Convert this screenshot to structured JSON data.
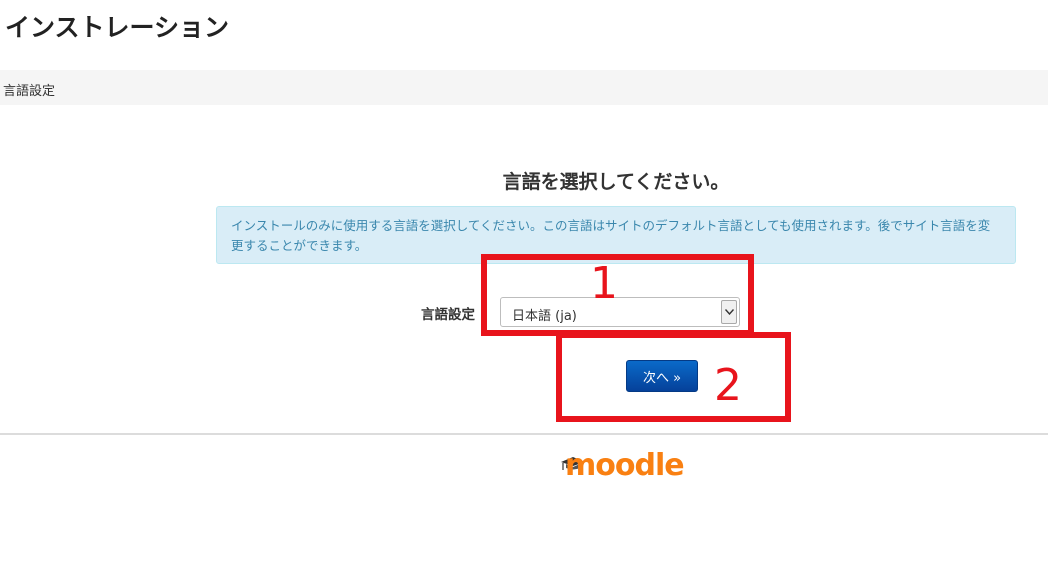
{
  "header": {
    "title": "インストレーション"
  },
  "breadcrumb": {
    "label": "言語設定"
  },
  "main": {
    "heading": "言語を選択してください。",
    "notice": "インストールのみに使用する言語を選択してください。この言語はサイトのデフォルト言語としても使用されます。後でサイト言語を変更することができます。",
    "language_field": {
      "label": "言語設定",
      "selected": "日本語 (ja)"
    },
    "next_button_label": "次へ »"
  },
  "annotations": {
    "first": "1",
    "second": "2",
    "color": "#e8141c"
  },
  "footer": {
    "logo_text": "moodle",
    "logo_color": "#f98012"
  }
}
